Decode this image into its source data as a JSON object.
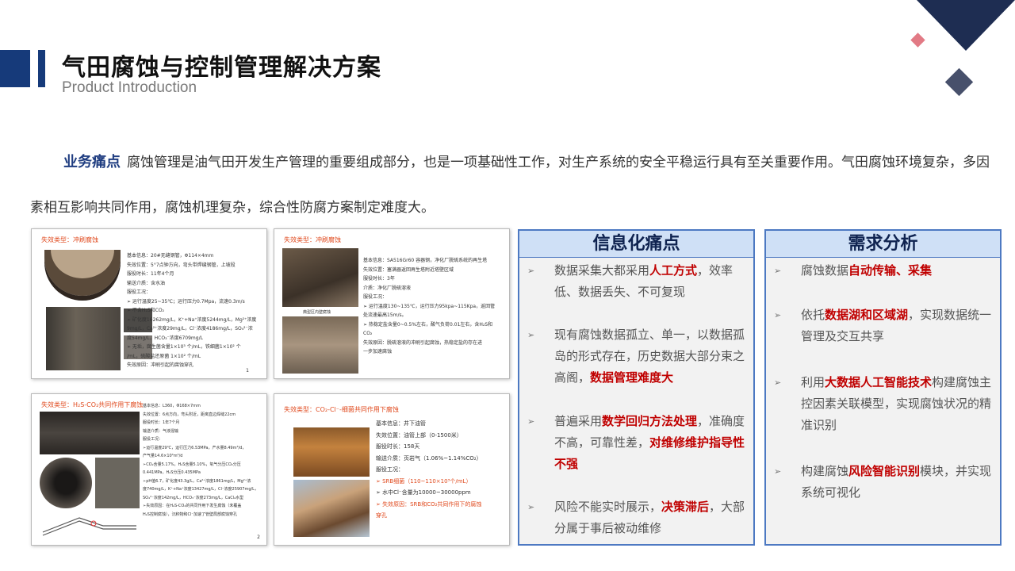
{
  "header": {
    "title": "气田腐蚀与控制管理解决方案",
    "subtitle": "Product Introduction"
  },
  "intro": {
    "highlight": "业务痛点",
    "text": "腐蚀管理是油气田开发生产管理的重要组成部分，也是一项基础性工作，对生产系统的安全平稳运行具有至关重要作用。气田腐蚀环境复杂，多因素相互影响共同作用，腐蚀机理复杂，综合性防腐方案制定难度大。"
  },
  "cards": [
    {
      "title": "失效类型：冲刷腐蚀",
      "lines": [
        "基本信息：20#无缝钢管，Φ114×4mm",
        "失效位置：5°7点钟方向，弯头带焊缝钢管，上坡段",
        "服役时长：11年4个月",
        "输送介质：含水油",
        "服役工况：",
        "➢ 运行温度25~35℃；运行压力0.7Mpa，流速0.3m/s",
        "➢ 不含H₂S和CO₂",
        "➢ 矿化度16262mg/L，K⁺+Na⁺浓度5244mg/L，Mg²⁺浓度",
        "   9mg/L，Ca²⁺浓度29mg/L，Cl⁻浓度4186mg/L，SO₄²⁻浓",
        "   度54mg/L，HCO₃⁻浓度6709mg/L",
        "➢ 无垢，腐生菌含量1×10³ 个/mL，铁细菌1×10² 个",
        "   /mL，硫酸盐还原菌 1×10² 个/mL",
        "失效原因：冲刷引起的腐蚀穿孔"
      ],
      "page": "1"
    },
    {
      "title": "失效类型：冲刷腐蚀",
      "caption": "典型区内壁腐蚀",
      "lines": [
        "基本信息：SA516Gr60 容器钢，净化厂脱硫系统的再生塔",
        "失效位置：塞满器返回再生塔附近塔壁区域",
        "服役时长：3年",
        "介质：净化厂脱硫溶液",
        "服役工况：",
        "➢ 运行温度130~135℃，运行压力95kpa~115Kpa，返回管",
        "   处流速最高15m/s。",
        "➢ 热稳定盐含量0~0.5%左右，酸气负荷0.01左右，含H₂S和",
        "   CO₂",
        "失效原因：脱硫溶液的冲刷引起腐蚀，热稳定盐的存在进",
        "   一步加速腐蚀"
      ]
    },
    {
      "title": "失效类型：H₂S-CO₂共同作用下腐蚀",
      "lines": [
        "基本信息：L360，Φ168×7mm",
        "失效位置：6点方向，弯头附近，距离直边焊缝22cm",
        "服役时长：1年7个月",
        "输送介质：气液混输",
        "服役工况：",
        "➢运行温度29℃，运行压力6.53MPa，产水量8.49m³/d，",
        "产气量14.6×10⁴m³/d",
        "➢CO₂含量5.17%，H₂S含量5.10%，氧气分压CO₂分压",
        "0.441MPa，H₂S分压0.435MPa",
        "➢pH值6.7，矿化度43.3g/L，Ca²⁺浓度1861mg/L，Mg²⁺浓",
        "度740mg/L，K⁺+Na⁺浓度13427mg/L，Cl⁻浓度25907mg/L，",
        "SO₄²⁻浓度142mg/L，HCO₃⁻浓度273mg/L，CaCl₂水型",
        "➢失效原因：在H₂S-CO₂的共同作用下发生腐蚀（未覆盖",
        "H₂S控制腐蚀），沉积物和Cl⁻加速了管壁局部腐蚀穿孔"
      ],
      "page": "2"
    },
    {
      "title": "失效类型：CO₂-Cl⁻-细菌共同作用下腐蚀",
      "lines": [
        "基本信息：井下油管",
        "失效位置：油管上部（0-1500米）",
        "服役时长：158天",
        "输送介质：页岩气（1.06%~1.14%CO₂）",
        "服役工况：",
        "➢ SRB细菌（110~110×10³个/mL）",
        "➢ 水中Cl⁻含量为10000~30000ppm",
        "➢ 失效原因：SRB和CO₂共同作用下的腐蚀",
        "   穿孔"
      ]
    }
  ],
  "panels": [
    {
      "title": "信息化痛点",
      "items": [
        [
          {
            "t": "数据采集大都采用"
          },
          {
            "t": "人工方式",
            "red": true
          },
          {
            "t": "，效率低、数据丢失、不可复现"
          }
        ],
        [
          {
            "t": "现有腐蚀数据孤立、单一，以数据孤岛的形式存在，历史数据大部分束之高阁，"
          },
          {
            "t": "数据管理难度大",
            "red": true
          }
        ],
        [
          {
            "t": "普遍采用"
          },
          {
            "t": "数学回归方法处理",
            "red": true
          },
          {
            "t": "，准确度不高，可靠性差，"
          },
          {
            "t": "对维修维护指导性不强",
            "red": true
          }
        ],
        [
          {
            "t": "风险不能实时展示，"
          },
          {
            "t": "决策滞后",
            "red": true
          },
          {
            "t": "，大部分属于事后被动维修"
          }
        ]
      ]
    },
    {
      "title": "需求分析",
      "items": [
        [
          {
            "t": "腐蚀数据"
          },
          {
            "t": "自动传输、采集",
            "red": true
          }
        ],
        [
          {
            "t": "依托"
          },
          {
            "t": "数据湖和区域湖",
            "red": true
          },
          {
            "t": "，实现数据统一管理及交互共享"
          }
        ],
        [
          {
            "t": "利用"
          },
          {
            "t": "大数据人工智能技术",
            "red": true
          },
          {
            "t": "构建腐蚀主控因素关联模型，实现腐蚀状况的精准识别"
          }
        ],
        [
          {
            "t": "构建腐蚀"
          },
          {
            "t": "风险智能识别",
            "red": true
          },
          {
            "t": "模块，并实现系统可视化"
          }
        ]
      ]
    }
  ],
  "icons": {
    "bullet": "arrow-bullet-icon"
  },
  "colors": {
    "navy": "#163a7a",
    "accent_red": "#c00000",
    "panel_head": "#cfe0f6",
    "panel_border": "#4d79c2"
  }
}
